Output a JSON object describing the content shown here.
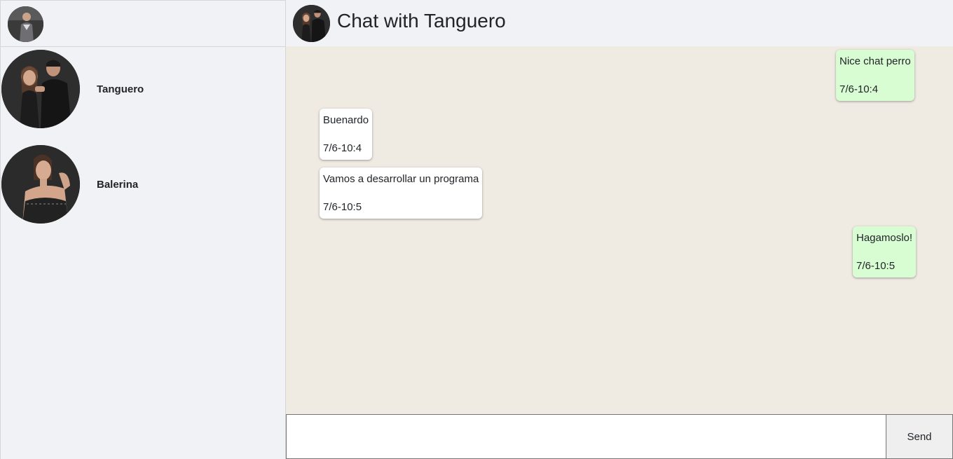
{
  "sidebar": {
    "contacts": [
      {
        "name": "Tanguero"
      },
      {
        "name": "Balerina"
      }
    ]
  },
  "chat": {
    "title": "Chat with Tanguero",
    "messages": [
      {
        "direction": "out",
        "text": "Nice chat perro",
        "time": "7/6-10:4"
      },
      {
        "direction": "in",
        "text": "Buenardo",
        "time": "7/6-10:4"
      },
      {
        "direction": "in",
        "text": "Vamos a desarrollar un programa",
        "time": "7/6-10:5"
      },
      {
        "direction": "out",
        "text": "Hagamoslo!",
        "time": "7/6-10:5"
      }
    ]
  },
  "composer": {
    "value": "",
    "send_label": "Send"
  },
  "colors": {
    "outgoing_bubble": "#d9fdd3",
    "incoming_bubble": "#ffffff",
    "chat_background": "#efeae2",
    "panel_background": "#f0f2f5"
  }
}
